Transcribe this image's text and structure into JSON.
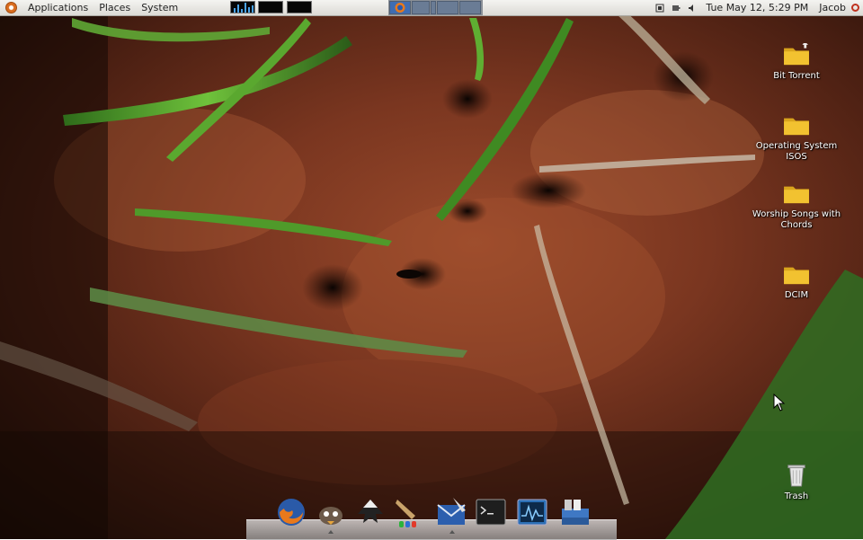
{
  "panel": {
    "menus": [
      "Applications",
      "Places",
      "System"
    ],
    "clock": "Tue May 12,  5:29 PM",
    "user": "Jacob"
  },
  "desktop": {
    "icons": [
      {
        "label": "Bit Torrent",
        "icon": "folder-icon"
      },
      {
        "label": "Operating System ISOS",
        "icon": "folder-icon"
      },
      {
        "label": "Worship Songs with Chords",
        "icon": "folder-icon"
      },
      {
        "label": "DCIM",
        "icon": "folder-icon"
      },
      {
        "label": "Trash",
        "icon": "trash-icon"
      }
    ]
  },
  "dock": {
    "items": [
      {
        "name": "firefox-icon"
      },
      {
        "name": "pidgin-icon"
      },
      {
        "name": "inkscape-icon"
      },
      {
        "name": "gimp-icon"
      },
      {
        "name": "evolution-icon"
      },
      {
        "name": "terminal-icon"
      },
      {
        "name": "system-monitor-icon"
      },
      {
        "name": "file-manager-icon"
      }
    ]
  },
  "colors": {
    "panel_bg": "#dcdad5",
    "folder": "#f2c230",
    "task_active": "#3f6db3"
  }
}
